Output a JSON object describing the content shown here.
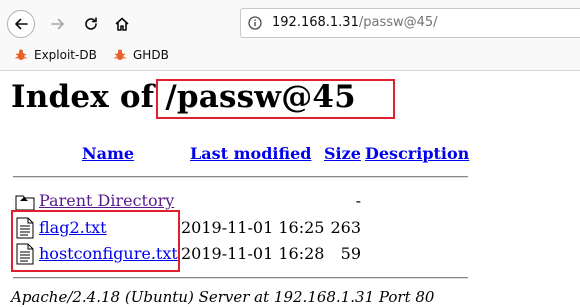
{
  "browser": {
    "url_host": "192.168.1.31",
    "url_path": "/passw@45/",
    "bookmarks": [
      {
        "label": "Exploit-DB"
      },
      {
        "label": "GHDB"
      }
    ]
  },
  "page": {
    "title": "Index of /passw@45",
    "columns": {
      "name": "Name",
      "last_modified": "Last modified",
      "size": "Size",
      "description": "Description"
    },
    "parent": {
      "label": "Parent Directory",
      "size": "-"
    },
    "files": [
      {
        "name": "flag2.txt",
        "modified": "2019-11-01 16:25",
        "size": "263"
      },
      {
        "name": "hostconfigure.txt",
        "modified": "2019-11-01 16:28",
        "size": "59"
      }
    ],
    "address": "Apache/2.4.18 (Ubuntu) Server at 192.168.1.31 Port 80"
  },
  "colors": {
    "highlight": "#e0202c",
    "link": "#0000ee",
    "visited": "#551a8b"
  }
}
